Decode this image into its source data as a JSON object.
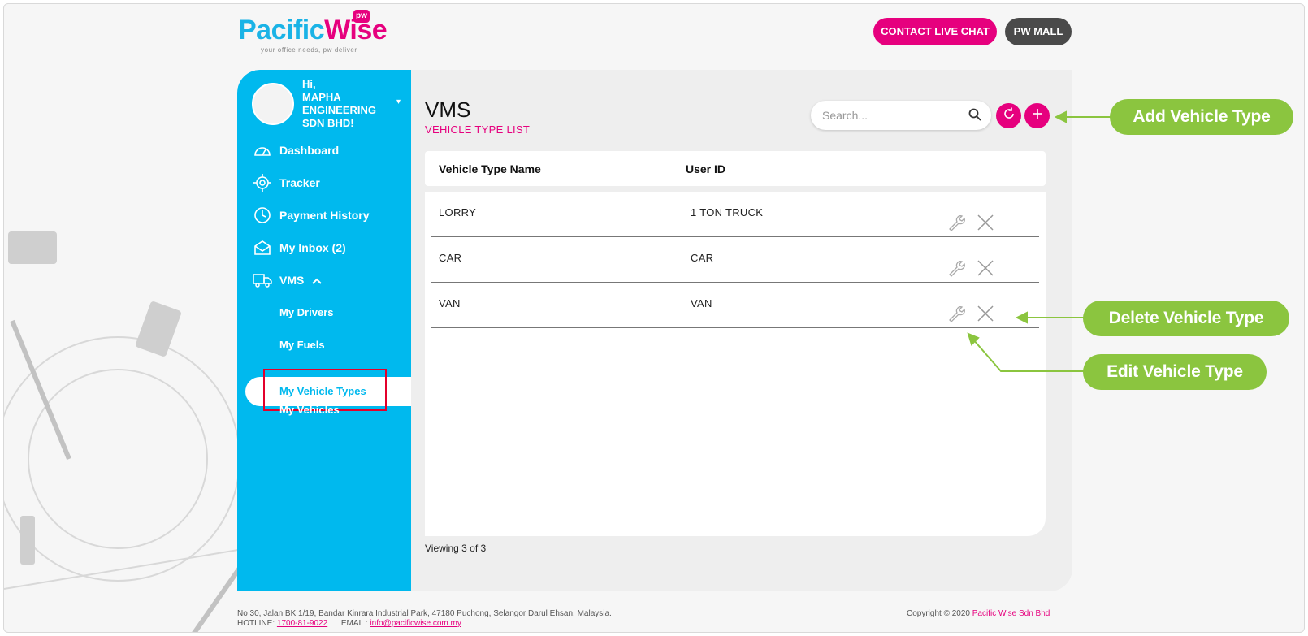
{
  "brand": {
    "logo_part1": "Pacific",
    "logo_part2": "Wise",
    "logo_badge": "pw",
    "tagline": "your office needs, pw deliver"
  },
  "header": {
    "chat_label": "CONTACT LIVE CHAT",
    "mall_label": "PW MALL"
  },
  "sidebar": {
    "greeting": "Hi,\nMAPHA ENGINEERING SDN BHD!",
    "greeting_line1": "Hi,",
    "greeting_line2": "MAPHA",
    "greeting_line3": "ENGINEERING",
    "greeting_line4": "SDN BHD!",
    "items": [
      {
        "label": "Dashboard",
        "icon": "dashboard-gauge-icon"
      },
      {
        "label": "Tracker",
        "icon": "crosshair-icon"
      },
      {
        "label": "Payment History",
        "icon": "clock-icon"
      },
      {
        "label": "My Inbox (2)",
        "icon": "envelope-icon"
      },
      {
        "label": "VMS",
        "icon": "truck-icon"
      }
    ],
    "vms_sub": [
      {
        "label": "My Drivers"
      },
      {
        "label": "My Fuels"
      },
      {
        "label": "My Vehicle Types",
        "active": true
      },
      {
        "label": "My Vehicles"
      }
    ]
  },
  "main": {
    "title": "VMS",
    "subtitle": "VEHICLE TYPE LIST",
    "search_placeholder": "Search...",
    "columns": [
      "Vehicle Type Name",
      "User ID"
    ],
    "rows": [
      {
        "name": "LORRY",
        "user_id": "1 TON TRUCK"
      },
      {
        "name": "CAR",
        "user_id": "CAR"
      },
      {
        "name": "VAN",
        "user_id": "VAN"
      }
    ],
    "viewing": "Viewing 3 of 3"
  },
  "footer": {
    "address": "No 30, Jalan BK 1/19, Bandar Kinrara Industrial Park, 47180 Puchong, Selangor Darul Ehsan, Malaysia.",
    "hotline_label": "HOTLINE:",
    "hotline": "1700-81-9022",
    "email_label": "EMAIL:",
    "email": "info@pacificwise.com.my",
    "copyright": "Copyright © 2020",
    "company": "Pacific Wise Sdn Bhd"
  },
  "callouts": {
    "add": "Add Vehicle Type",
    "delete": "Delete Vehicle Type",
    "edit": "Edit Vehicle Type"
  },
  "colors": {
    "brand_blue": "#00b9ee",
    "brand_pink": "#e6007e",
    "callout_green": "#8bc53f",
    "highlight_red": "#e3002b"
  }
}
